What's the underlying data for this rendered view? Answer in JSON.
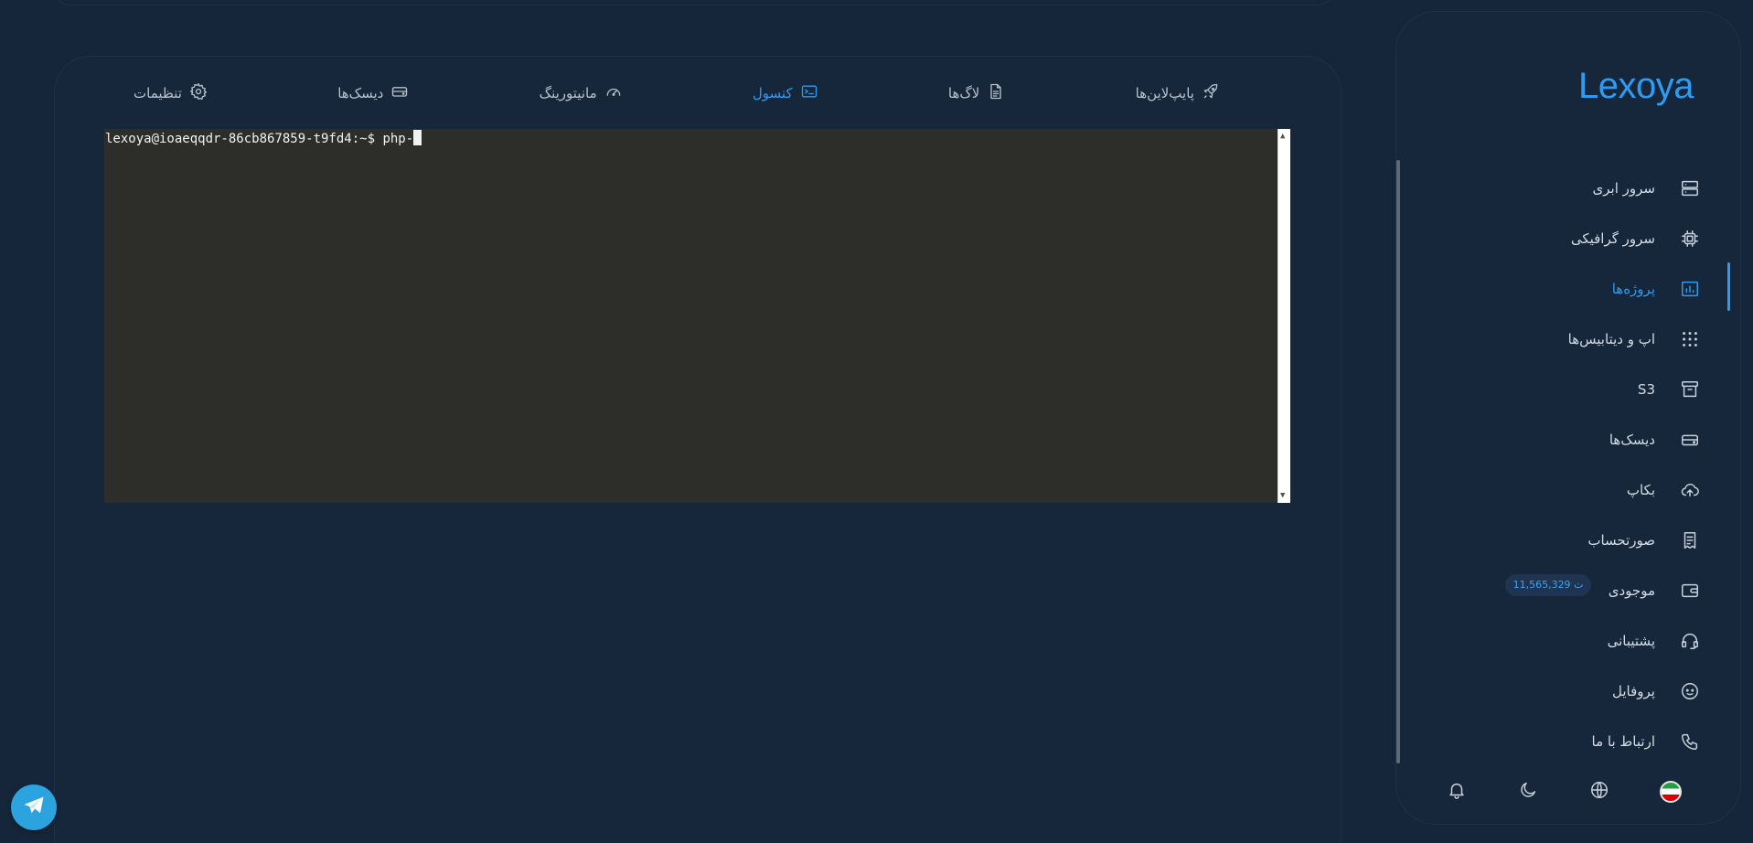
{
  "tabs": [
    {
      "label": "پایپ‌لاین‌ها",
      "icon": "rocket-icon",
      "active": false
    },
    {
      "label": "لاگ‌ها",
      "icon": "file-text-icon",
      "active": false
    },
    {
      "label": "کنسول",
      "icon": "terminal-icon",
      "active": true
    },
    {
      "label": "مانیتورینگ",
      "icon": "gauge-icon",
      "active": false
    },
    {
      "label": "دیسک‌ها",
      "icon": "disk-icon",
      "active": false
    },
    {
      "label": "تنظیمات",
      "icon": "gear-icon",
      "active": false
    }
  ],
  "terminal": {
    "prompt": "lexoya@ioaeqqdr-86cb867859-t9fd4:~$ ",
    "input": "php-"
  },
  "sidebar": {
    "logo": "Lexoya",
    "items": [
      {
        "label": "سرور ابری",
        "icon": "server-icon"
      },
      {
        "label": "سرور گرافیکی",
        "icon": "chip-icon"
      },
      {
        "label": "پروژه‌ها",
        "icon": "chart-board-icon",
        "active": true
      },
      {
        "label": "اپ و دیتابیس‌ها",
        "icon": "grid-dots-icon"
      },
      {
        "label": "S3",
        "icon": "archive-icon"
      },
      {
        "label": "دیسک‌ها",
        "icon": "disk-icon"
      },
      {
        "label": "بکاپ",
        "icon": "cloud-upload-icon"
      },
      {
        "label": "صورتحساب",
        "icon": "receipt-icon"
      },
      {
        "label": "موجودی",
        "icon": "wallet-icon"
      },
      {
        "label": "پشتیبانی",
        "icon": "headset-icon"
      },
      {
        "label": "پروفایل",
        "icon": "face-icon"
      },
      {
        "label": "ارتباط با ما",
        "icon": "phone-icon"
      }
    ],
    "balance_badge": "11,565,329 ت"
  },
  "footer": {
    "icons": [
      "flag-iran-icon",
      "globe-icon",
      "moon-icon",
      "bell-icon"
    ]
  },
  "colors": {
    "accent": "#2e9bf0",
    "background": "#16263a",
    "terminal_bg": "#2d2d2a"
  }
}
